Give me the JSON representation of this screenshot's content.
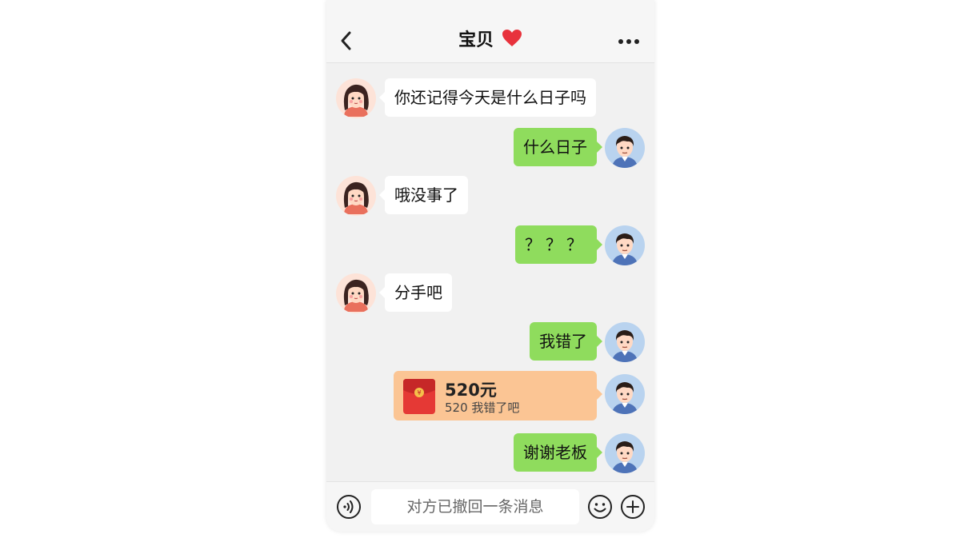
{
  "header": {
    "title": "宝贝",
    "back_icon": "chevron-left-icon",
    "heart_icon": "red-heart-icon",
    "more_icon": "more-horizontal-icon"
  },
  "messages": [
    {
      "sender": "her",
      "text": "你还记得今天是什么日子吗"
    },
    {
      "sender": "me",
      "text": "什么日子"
    },
    {
      "sender": "her",
      "text": "哦没事了"
    },
    {
      "sender": "me",
      "text": "？？？"
    },
    {
      "sender": "her",
      "text": "分手吧"
    },
    {
      "sender": "me",
      "text": "我错了"
    },
    {
      "sender": "me",
      "type": "red-packet",
      "amount": "520元",
      "note": "520 我错了吧"
    },
    {
      "sender": "me",
      "text": "谢谢老板"
    }
  ],
  "input_bar": {
    "placeholder": "对方已撤回一条消息",
    "voice_icon": "voice-icon",
    "emoji_icon": "emoji-icon",
    "plus_icon": "plus-icon"
  },
  "colors": {
    "sent_bubble": "#8fdc5d",
    "received_bubble": "#ffffff",
    "red_packet_card": "#fbc594",
    "red_packet_icon": "#e53935",
    "background": "#f1f1f1"
  }
}
